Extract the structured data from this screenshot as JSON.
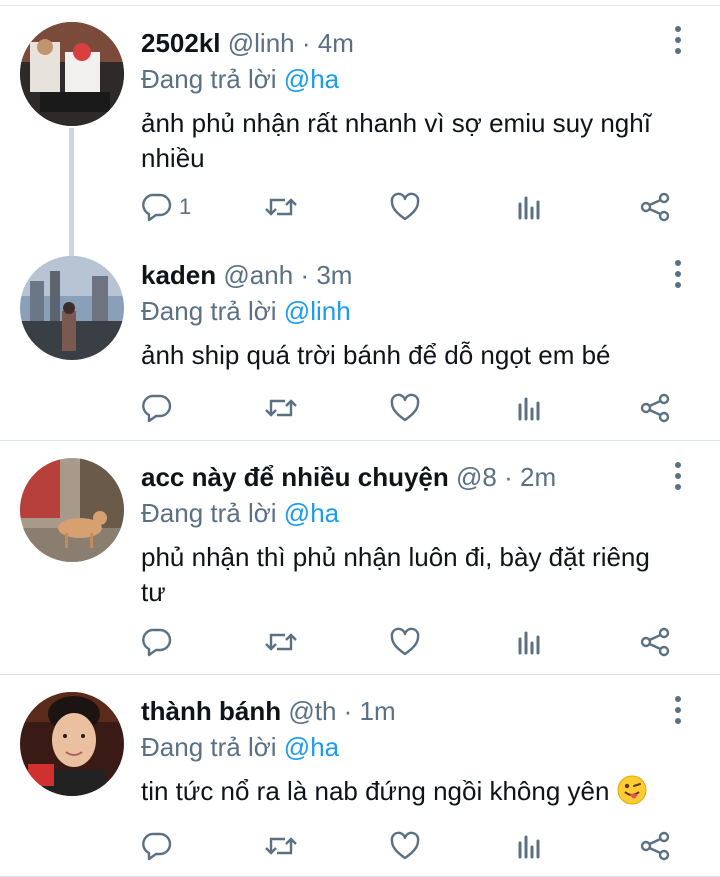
{
  "tweets": [
    {
      "name": "2502kl",
      "handle": "@linh",
      "separator": "·",
      "time": "4m",
      "reply_prefix": "Đang trả lời",
      "reply_to": "@ha",
      "text": "ảnh phủ nhận rất nhanh vì sợ emiu suy nghĩ nhiều",
      "reply_count": "1"
    },
    {
      "name": "kaden",
      "handle": "@anh",
      "separator": "·",
      "time": "3m",
      "reply_prefix": "Đang trả lời",
      "reply_to": "@linh",
      "text": "ảnh ship quá trời bánh để dỗ ngọt em bé",
      "reply_count": ""
    },
    {
      "name": "acc này để nhiều chuyện",
      "handle": "@8",
      "separator": "·",
      "time": "2m",
      "reply_prefix": "Đang trả lời",
      "reply_to": "@ha",
      "text": "phủ nhận thì phủ nhận luôn đi, bày đặt riêng tư",
      "reply_count": ""
    },
    {
      "name": "thành bánh",
      "handle": "@th",
      "separator": "·",
      "time": "1m",
      "reply_prefix": "Đang trả lời",
      "reply_to": "@ha",
      "text": "tin tức nổ ra là nab đứng ngồi không yên",
      "reply_count": ""
    }
  ],
  "icons": {
    "reply": "reply-icon",
    "retweet": "retweet-icon",
    "like": "heart-icon",
    "views": "analytics-icon",
    "share": "share-icon",
    "more": "more-icon",
    "emoji": "winking-tongue-emoji-icon"
  },
  "colors": {
    "text": "#0f1419",
    "secondary": "#5b7083",
    "mention": "#1d9bf0",
    "divider": "#dfe4e8"
  }
}
